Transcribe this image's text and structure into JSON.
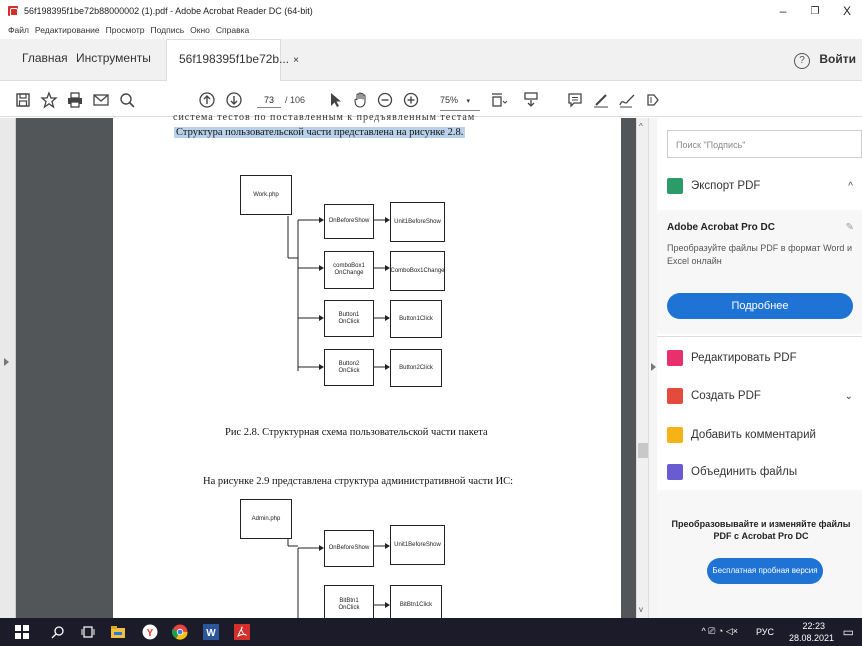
{
  "window": {
    "title": "56f198395f1be72b88000002 (1).pdf - Adobe Acrobat Reader DC (64-bit)"
  },
  "menu": [
    "Файл",
    "Редактирование",
    "Просмотр",
    "Подпись",
    "Окно",
    "Справка"
  ],
  "tabs": {
    "home": "Главная",
    "tools": "Инструменты",
    "doc": "56f198395f1be72b...",
    "doc_close": "×"
  },
  "header": {
    "help": "?",
    "login": "Войти"
  },
  "toolbar": {
    "page_current": "73",
    "page_total": "/ 106",
    "zoom": "75%"
  },
  "page": {
    "top_cut": "система  тестов  по  поставленным  к  предъявленным  тестам",
    "intro": "Структура пользовательской части представлена на рисунке 2.8.",
    "caption": "Рис 2.8. Структурная схема пользовательской части пакета",
    "intro2": "На рисунке 2.9 представлена структура административной части ИС:"
  },
  "diagram1": {
    "root": "Work.php",
    "events": [
      "OnBeforeShow",
      "comboBox1\nOnChange",
      "Button1\nOnClick",
      "Button2\nOnClick"
    ],
    "handlers": [
      "Unit1BeforeShow",
      "ComboBox1Change",
      "Button1Click",
      "Button2Click"
    ]
  },
  "diagram2": {
    "root": "Admin.php",
    "events": [
      "OnBeforeShow",
      "BitBtn1\nOnClick"
    ],
    "handlers": [
      "Unit1BeforeShow",
      "BitBtn1Click"
    ]
  },
  "panel": {
    "search_placeholder": "Поиск \"Подпись\"",
    "export_pdf": "Экспорт PDF",
    "promo_title": "Adobe Acrobat Pro DC",
    "promo_desc": "Преобразуйте файлы PDF в формат Word и Excel онлайн",
    "more_button": "Подробнее",
    "edit_pdf": "Редактировать PDF",
    "create_pdf": "Создать PDF",
    "add_comment": "Добавить комментарий",
    "combine": "Объединить файлы",
    "bottom_promo": "Преобразовывайте и изменяйте файлы PDF с Acrobat Pro DC",
    "trial_button": "Бесплатная пробная версия"
  },
  "tray": {
    "lang": "РУС",
    "time": "22:23",
    "date": "28.08.2021"
  },
  "colors": {
    "accent": "#1f73d4",
    "taskbar": "#1b1b2a",
    "highlight": "#b9d1ea"
  }
}
